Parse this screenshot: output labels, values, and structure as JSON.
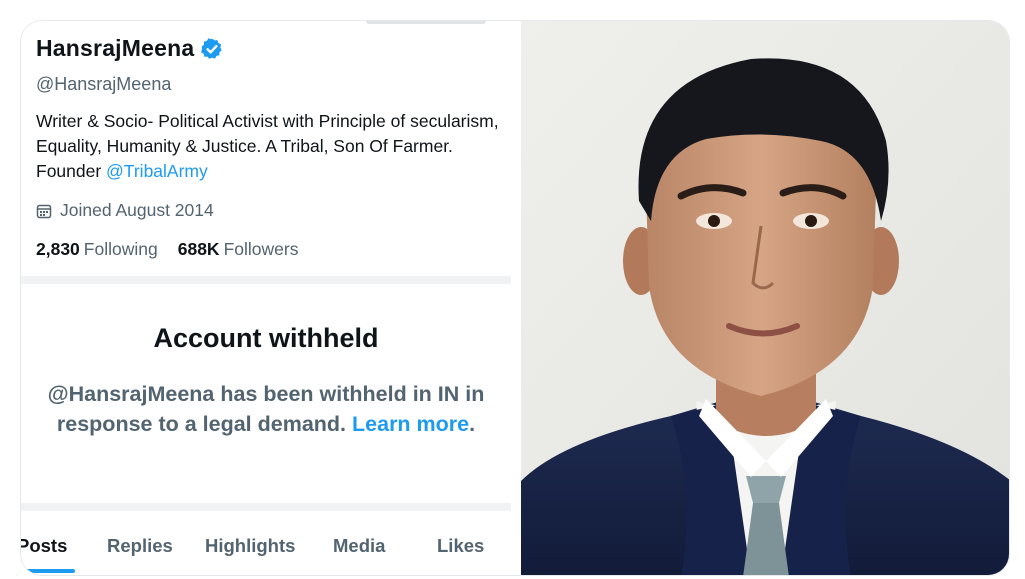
{
  "profile": {
    "display_name": "HansrajMeena",
    "handle": "@HansrajMeena",
    "bio_text": "Writer & Socio- Political Activist with Principle of secularism, Equality, Humanity & Justice. A Tribal, Son Of Farmer. Founder ",
    "bio_mention": "@TribalArmy",
    "joined": "Joined August 2014",
    "following_count": "2,830",
    "following_label": "Following",
    "followers_count": "688K",
    "followers_label": "Followers",
    "verified_icon": "verified-badge-icon",
    "calendar_icon": "calendar-icon"
  },
  "withheld": {
    "title": "Account withheld",
    "message": "@HansrajMeena has been withheld in IN in response to a legal demand. ",
    "link_text": "Learn more",
    "trailing": "."
  },
  "tabs": [
    {
      "label": "Posts",
      "active": true
    },
    {
      "label": "Replies",
      "active": false
    },
    {
      "label": "Highlights",
      "active": false
    },
    {
      "label": "Media",
      "active": false
    },
    {
      "label": "Likes",
      "active": false
    }
  ],
  "colors": {
    "accent": "#1d9bf0",
    "text_primary": "#0f1419",
    "text_secondary": "#536471"
  }
}
